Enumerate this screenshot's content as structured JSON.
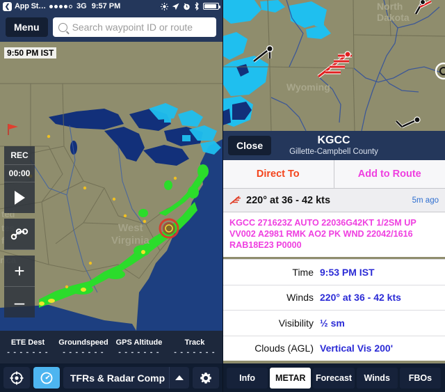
{
  "status_bar": {
    "back_label": "❮",
    "app_label": "App St…",
    "signal_dots": 5,
    "signal_filled": 4,
    "carrier": "3G",
    "time": "9:57 PM",
    "icons": [
      "brightness-icon",
      "location-arrow-icon",
      "alarm-clock-icon",
      "bluetooth-icon",
      "battery-icon"
    ],
    "battery_level_pct": 88
  },
  "left_pane": {
    "menu_label": "Menu",
    "search": {
      "placeholder": "Search waypoint ID or route",
      "value": ""
    },
    "map": {
      "radar_timestamp": "9:50 PM IST",
      "labels": [
        "West Virginia"
      ],
      "colors": {
        "land": "#8f8d6d",
        "water": "#1d3f80",
        "radar_green": "#2bdc2b",
        "radar_yellow": "#f2e32b",
        "tfr_ring": "#d93a2b"
      }
    },
    "map_tools": [
      {
        "name": "rec-button",
        "label": "REC"
      },
      {
        "name": "timer-readout",
        "label": "00:00"
      },
      {
        "name": "play-button",
        "label": ""
      },
      {
        "name": "route-button",
        "label": ""
      },
      {
        "name": "zoom-in-button",
        "label": "+"
      },
      {
        "name": "zoom-out-button",
        "label": "–"
      }
    ],
    "data_strip": [
      {
        "label": "ETE Dest",
        "value": "- - - - - - -"
      },
      {
        "label": "Groundspeed",
        "value": "- - - - - - -"
      },
      {
        "label": "GPS Altitude",
        "value": "- - - - - - -"
      },
      {
        "label": "Track",
        "value": "- - - - - - -"
      }
    ],
    "bottom_bar": {
      "center_icon": "crosshair-target-icon",
      "gauge_icon": "gauge-icon",
      "gauge_active": true,
      "layer_label": "TFRs & Radar Comp",
      "caret_icon": "caret-up-icon",
      "settings_icon": "gear-icon"
    }
  },
  "right_pane": {
    "map": {
      "labels": [
        "North Dakota",
        "Wyoming"
      ],
      "wind_barbs": 4,
      "colors": {
        "land": "#8f8d6d",
        "river": "#2f4f9e",
        "radar_cyan": "#1fbfef",
        "radar_deep": "#12307a",
        "barb_red": "#e02020"
      }
    },
    "panel": {
      "close_label": "Close",
      "identifier": "KGCC",
      "name": "Gillette-Campbell County",
      "direct_to_label": "Direct To",
      "direct_to_color": "#f4441c",
      "add_route_label": "Add to Route",
      "add_route_color": "#ef3fe0",
      "wind_summary": "220° at 36 - 42 kts",
      "wind_icon": "wind-barb-icon",
      "age": "5m ago",
      "raw_metar": "KGCC 271623Z AUTO 22036G42KT 1/2SM UP VV002 A2981 RMK AO2 PK WND 22042/1616 RAB18E23 P0000",
      "fields": [
        {
          "key": "Time",
          "value": "9:53 PM IST"
        },
        {
          "key": "Winds",
          "value": "220° at 36 - 42 kts"
        },
        {
          "key": "Visibility",
          "value": "½ sm"
        },
        {
          "key": "Clouds (AGL)",
          "value": "Vertical Vis 200'"
        }
      ]
    },
    "tabs": [
      {
        "label": "Info",
        "active": false
      },
      {
        "label": "METAR",
        "active": true
      },
      {
        "label": "Forecast",
        "active": false
      },
      {
        "label": "Winds",
        "active": false
      },
      {
        "label": "FBOs",
        "active": false
      }
    ]
  }
}
